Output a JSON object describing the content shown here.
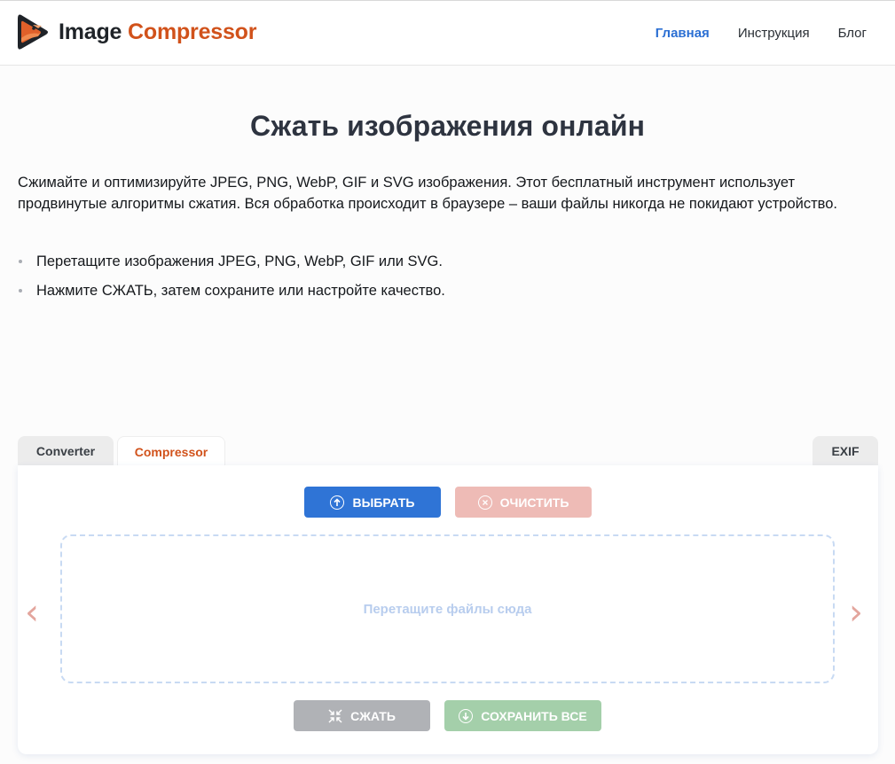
{
  "header": {
    "logo": {
      "word1": "Image",
      "word2": "Compressor",
      "icon": "bird-logo-icon"
    },
    "nav": [
      {
        "label": "Главная",
        "active": true
      },
      {
        "label": "Инструкция",
        "active": false
      },
      {
        "label": "Блог",
        "active": false
      }
    ]
  },
  "main": {
    "title": "Сжать изображения онлайн",
    "intro": "Сжимайте и оптимизируйте JPEG, PNG, WebP, GIF и SVG изображения. Этот бесплатный инструмент использует продвинутые алгоритмы сжатия. Вся обработка происходит в браузере – ваши файлы никогда не покидают устройство.",
    "tips": [
      "Перетащите изображения JPEG, PNG, WebP, GIF или SVG.",
      "Нажмите СЖАТЬ, затем сохраните или настройте качество."
    ]
  },
  "tabs": [
    {
      "label": "Converter",
      "active": false
    },
    {
      "label": "Compressor",
      "active": true
    },
    {
      "label": "EXIF",
      "active": false
    }
  ],
  "tool": {
    "select_label": "ВЫБРАТЬ",
    "clear_label": "ОЧИСТИТЬ",
    "dropzone_text": "Перетащите файлы сюда",
    "prev_arrow": "‹",
    "next_arrow": "›",
    "compress_label": "СЖАТЬ",
    "save_all_label": "СОХРАНИТЬ ВСЕ",
    "icons": {
      "select": "upload-arrow-icon",
      "clear": "close-circle-icon",
      "compress": "compress-icon",
      "save_all": "download-arrow-icon"
    }
  },
  "colors": {
    "brand_orange": "#d1521b",
    "primary_blue": "#2f74d6",
    "clear_disabled": "#eebbb6",
    "compress_disabled": "#b0b2b6",
    "save_disabled": "#a4cfaa"
  }
}
